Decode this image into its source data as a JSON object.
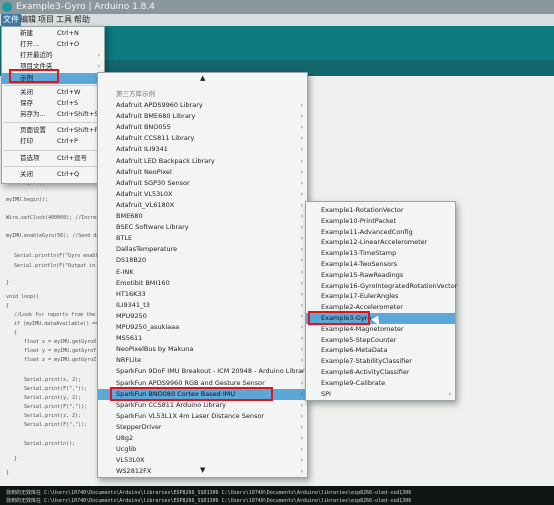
{
  "window": {
    "title": "Example3-Gyro | Arduino 1.8.4"
  },
  "menubar": {
    "items": [
      "文件",
      "编辑",
      "项目",
      "工具",
      "帮助"
    ]
  },
  "file_menu": {
    "items": [
      {
        "label": "新建",
        "shortcut": "Ctrl+N"
      },
      {
        "label": "打开...",
        "shortcut": "Ctrl+O"
      },
      {
        "label": "打开最近的",
        "arrow": "›"
      },
      {
        "label": "项目文件夹",
        "arrow": "›"
      },
      {
        "label": "示例",
        "arrow": "›"
      },
      {
        "label": "关闭",
        "shortcut": "Ctrl+W"
      },
      {
        "label": "保存",
        "shortcut": "Ctrl+S"
      },
      {
        "label": "另存为...",
        "shortcut": "Ctrl+Shift+S"
      },
      {
        "label": "页面设置",
        "shortcut": "Ctrl+Shift+P"
      },
      {
        "label": "打印",
        "shortcut": "Ctrl+P"
      },
      {
        "label": "首选项",
        "shortcut": "Ctrl+逗号"
      },
      {
        "label": "关闭",
        "shortcut": "Ctrl+Q"
      }
    ]
  },
  "examples_menu": {
    "header": "第三方库示例",
    "items": [
      "Adafruit APDS9960 Library",
      "Adafruit BME680 Library",
      "Adafruit BNO055",
      "Adafruit CCS811 Library",
      "Adafruit ILI9341",
      "Adafruit LED Backpack Library",
      "Adafruit NeoPixel",
      "Adafruit SGP30 Sensor",
      "Adafruit VL53L0X",
      "Adafruit_VL6180X",
      "BME680",
      "BSEC Software Library",
      "BTLE",
      "DallasTemperature",
      "DS18B20",
      "E-INK",
      "Emotibit BMI160",
      "HT16K33",
      "ILI9341_t3",
      "MPU9250",
      "MPU9250_asukiaaa",
      "MS5611",
      "NeoPixelBus by Makuna",
      "NRFLite",
      "SparkFun 9DoF IMU Breakout - ICM 20948 - Arduino Library",
      "SparkFun APDS9960 RGB and Gesture Sensor",
      "SparkFun BNO080 Cortex Based IMU",
      "SparkFun CCS811 Arduino Library",
      "SparkFun VL53L1X 4m Laser Distance Sensor",
      "StepperDriver",
      "U8g2",
      "Ucglib",
      "VL53L0X",
      "WS2812FX"
    ],
    "arrow": "›",
    "scroll_up": "▲",
    "scroll_down": "▼"
  },
  "bno080_menu": {
    "items": [
      "Example1-RotationVector",
      "Example10-PrintPacket",
      "Example11-AdvancedConfig",
      "Example12-LinearAccelerometer",
      "Example13-TimeStamp",
      "Example14-TwoSensors",
      "Example15-RawReadings",
      "Example16-GyroIntegratedRotationVector",
      "Example17-EulerAngles",
      "Example2-Accelerometer",
      "Example3-Gyro",
      "Example4-Magnetometer",
      "Example5-StepCounter",
      "Example6-MetaData",
      "Example7-StabilityClassifier",
      "Example8-ActivityClassifier",
      "Example9-Calibrate",
      "SPI"
    ],
    "spi_arrow": "›"
  },
  "code_lines": [
    "Wire.begin();",
    "myIMU.begin();",
    "Wire.setClock(400000); //Increase I2C data rate to 400kHz",
    "myIMU.enableGyro(50); //Send data update every 50ms",
    "Serial.println(F(\"Gyro enabled\"));",
    "Serial.println(F(\"Output in form x, y, z, in radians per second\"));",
    "}",
    "void loop()",
    "{",
    "//Look for reports from the IMU",
    "if (myIMU.dataAvailable() == true)",
    "{",
    "float x = myIMU.getGyroX();",
    "float y = myIMU.getGyroY();",
    "float z = myIMU.getGyroZ();",
    "Serial.print(x, 2);",
    "Serial.print(F(\",\"));",
    "Serial.print(y, 2);",
    "Serial.print(F(\",\"));",
    "Serial.print(z, 2);",
    "Serial.print(F(\",\"));",
    "Serial.println();",
    "}",
    "}"
  ],
  "console_lines": [
    "找到的无效库在 C:\\Users\\10740\\Documents\\Arduino\\libraries\\ESP8266_SSD1306 C:\\Users\\10740\\Documents\\Arduino\\libraries\\esp8266-oled-ssd1306",
    "找到的无效库在 C:\\Users\\10740\\Documents\\Arduino\\libraries\\ESP8266_SSD1306 C:\\Users\\10740\\Documents\\Arduino\\libraries\\esp8266-oled-ssd1306"
  ],
  "colors": {
    "highlight": "#5da6d8",
    "annotation": "#e0151b",
    "toolbar": "#0c7a7f"
  }
}
